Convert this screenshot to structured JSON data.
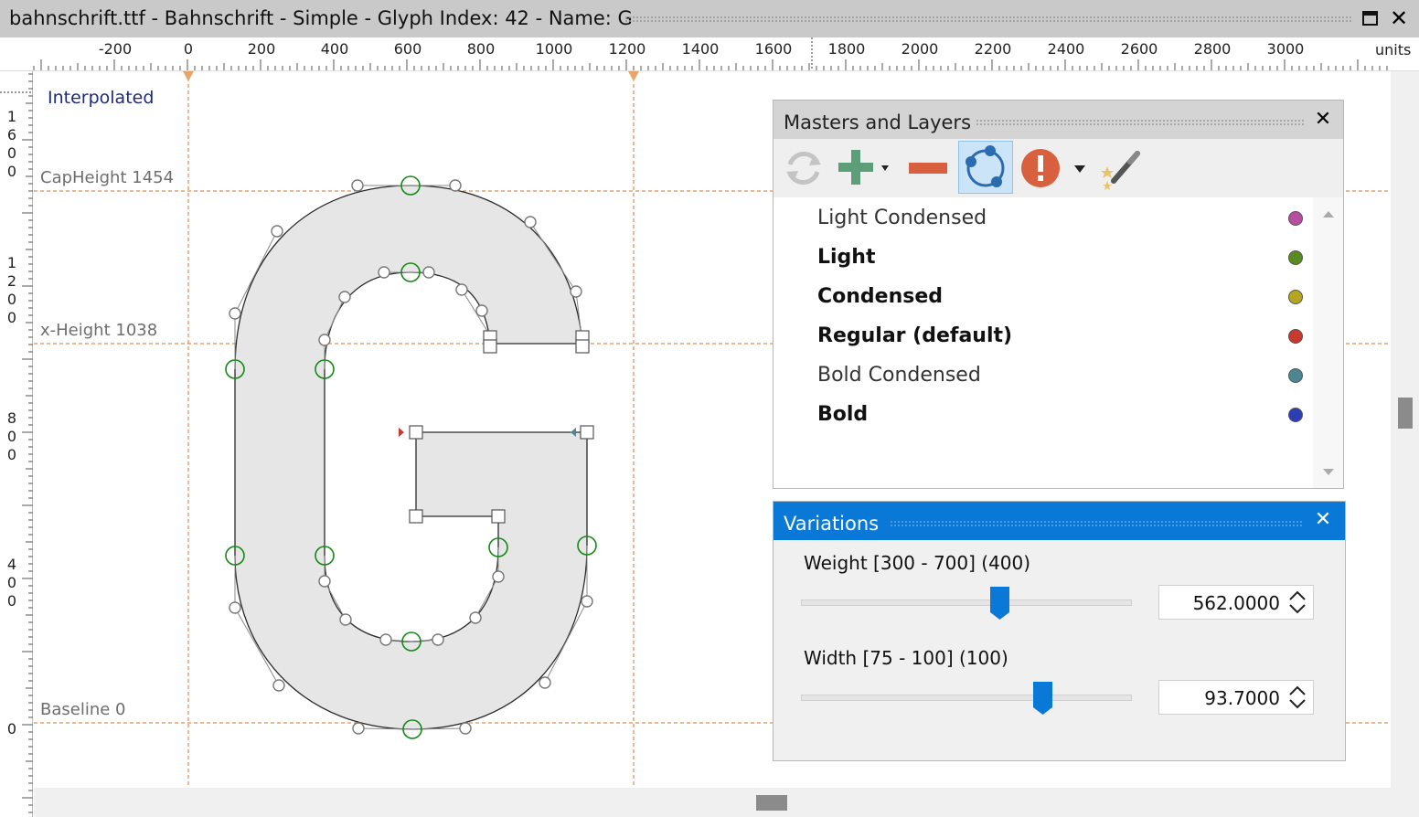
{
  "window": {
    "title": "bahnschrift.ttf - Bahnschrift - Simple - Glyph Index: 42 - Name: G"
  },
  "ruler": {
    "labels": [
      "-200",
      "0",
      "200",
      "400",
      "600",
      "800",
      "1000",
      "1200",
      "1400",
      "1600",
      "1800",
      "2000",
      "2200",
      "2400",
      "2600",
      "2800",
      "3000"
    ],
    "units": "units",
    "vertical_digits": [
      [
        "1",
        "6",
        "0",
        "0"
      ],
      [
        "1",
        "2",
        "0",
        "0"
      ],
      [
        "8",
        "0",
        "0"
      ],
      [
        "4",
        "0",
        "0"
      ],
      [
        "0"
      ]
    ]
  },
  "canvas": {
    "mode_label": "Interpolated",
    "cap_height": "CapHeight 1454",
    "x_height": "x-Height 1038",
    "baseline": "Baseline 0"
  },
  "masters_panel": {
    "title": "Masters and Layers",
    "toolbar_icons": [
      "refresh-icon",
      "add-icon",
      "remove-icon",
      "interpolate-icon",
      "warning-icon",
      "magic-wand-icon"
    ],
    "items": [
      {
        "label": "Light Condensed",
        "bold": false,
        "color": "#b84ea0"
      },
      {
        "label": "Light",
        "bold": true,
        "color": "#5a8a22"
      },
      {
        "label": "Condensed",
        "bold": true,
        "color": "#b5a520"
      },
      {
        "label": "Regular (default)",
        "bold": true,
        "color": "#c8392e"
      },
      {
        "label": "Bold Condensed",
        "bold": false,
        "color": "#4a8793"
      },
      {
        "label": "Bold",
        "bold": true,
        "color": "#2b3fb5"
      }
    ]
  },
  "variations_panel": {
    "title": "Variations",
    "axes": [
      {
        "label": "Weight [300 - 700] (400)",
        "value": "562.0000",
        "fraction": 0.6
      },
      {
        "label": "Width [75 - 100] (100)",
        "value": "93.7000",
        "fraction": 0.73
      }
    ]
  },
  "colors": {
    "accent": "#0a78d7",
    "guide": "#d9722e",
    "oncurve": "#138a13"
  }
}
